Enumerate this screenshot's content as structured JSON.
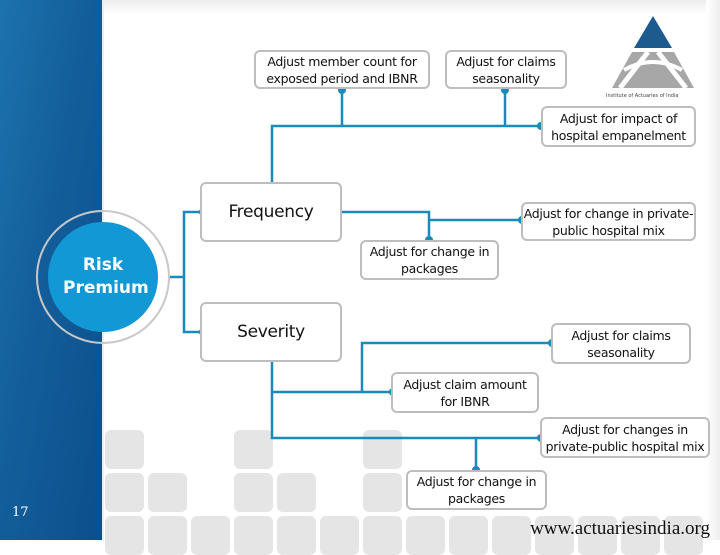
{
  "slide": {
    "page_number": "17",
    "website": "www.actuariesindia.org",
    "logo_caption": "Institute of Actuaries of India",
    "colors": {
      "sidebar": "#135e9a",
      "accent_circle": "#1398d6",
      "connector": "#1a8bb8",
      "box_border": "#bdbdbd",
      "logo_top": "#1d5a8e",
      "logo_bottom": "#a7a7a7",
      "tile": "#e5e5e5"
    }
  },
  "diagram": {
    "root": "Risk Premium",
    "branches": [
      {
        "name": "Frequency",
        "adjustments": [
          "Adjust member count for exposed period and IBNR",
          "Adjust for claims seasonality",
          "Adjust for impact of hospital empanelment",
          "Adjust for change in private-public hospital mix",
          "Adjust for change in packages"
        ]
      },
      {
        "name": "Severity",
        "adjustments": [
          "Adjust for claims seasonality",
          "Adjust claim amount for IBNR",
          "Adjust for changes in private-public hospital mix",
          "Adjust for change in packages"
        ]
      }
    ]
  }
}
